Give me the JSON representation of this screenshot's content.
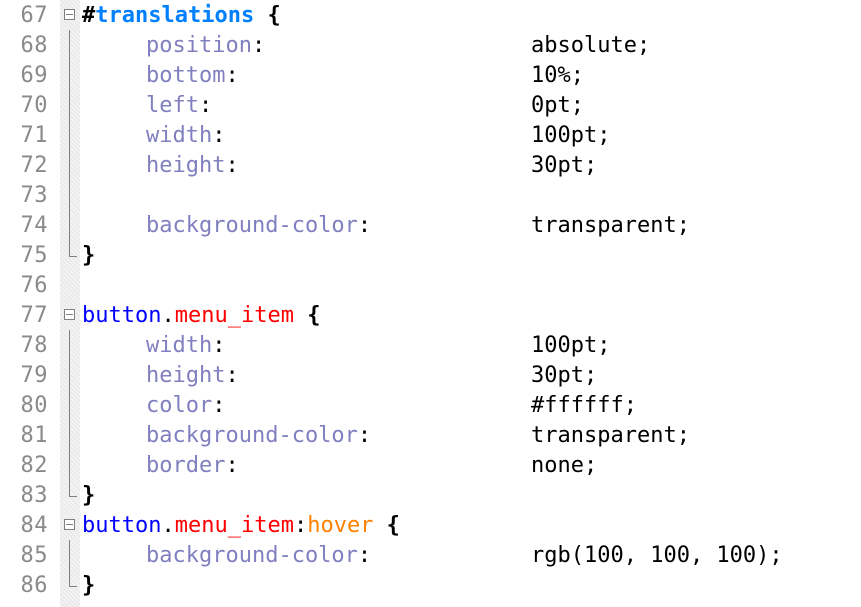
{
  "editor": {
    "lines": [
      {
        "num": "67",
        "kind": "selector",
        "hash": "#",
        "id_name": "translations",
        "brace": " {",
        "fold": "open"
      },
      {
        "num": "68",
        "kind": "decl",
        "prop": "position",
        "value": "absolute",
        "end": ";"
      },
      {
        "num": "69",
        "kind": "decl",
        "prop": "bottom",
        "value": "10%",
        "end": ";"
      },
      {
        "num": "70",
        "kind": "decl",
        "prop": "left",
        "value": "0pt",
        "end": ";"
      },
      {
        "num": "71",
        "kind": "decl",
        "prop": "width",
        "value": "100pt",
        "end": ";"
      },
      {
        "num": "72",
        "kind": "decl",
        "prop": "height",
        "value": "30pt",
        "end": ";"
      },
      {
        "num": "73",
        "kind": "blank"
      },
      {
        "num": "74",
        "kind": "decl",
        "prop": "background-color",
        "value": "transparent",
        "end": ";"
      },
      {
        "num": "75",
        "kind": "close",
        "brace": "}"
      },
      {
        "num": "76",
        "kind": "empty"
      },
      {
        "num": "77",
        "kind": "selector2",
        "tag": "button",
        "dot": ".",
        "cls": "menu_item",
        "brace": " {",
        "fold": "open"
      },
      {
        "num": "78",
        "kind": "decl",
        "prop": "width",
        "value": "100pt",
        "end": ";"
      },
      {
        "num": "79",
        "kind": "decl",
        "prop": "height",
        "value": "30pt",
        "end": ";"
      },
      {
        "num": "80",
        "kind": "decl",
        "prop": "color",
        "value": "#ffffff",
        "end": ";"
      },
      {
        "num": "81",
        "kind": "decl",
        "prop": "background-color",
        "value": "transparent",
        "end": ";"
      },
      {
        "num": "82",
        "kind": "decl",
        "prop": "border",
        "value": "none",
        "end": ";"
      },
      {
        "num": "83",
        "kind": "close",
        "brace": "}"
      },
      {
        "num": "84",
        "kind": "selector3",
        "tag": "button",
        "dot": ".",
        "cls": "menu_item",
        "pcolon": ":",
        "pseudo": "hover",
        "brace": " {",
        "fold": "open"
      },
      {
        "num": "85",
        "kind": "decl",
        "prop": "background-color",
        "value": "rgb(100, 100, 100)",
        "end": ";"
      },
      {
        "num": "86",
        "kind": "close",
        "brace": "}"
      }
    ]
  },
  "colors": {
    "line_number": "#8a8a8a",
    "property": "#8080c0",
    "id_selector": "#0080ff",
    "tag_selector": "#0000ff",
    "class_selector": "#ff0000",
    "pseudo_class": "#ff8000",
    "fold_margin": "#f3f3f3"
  }
}
